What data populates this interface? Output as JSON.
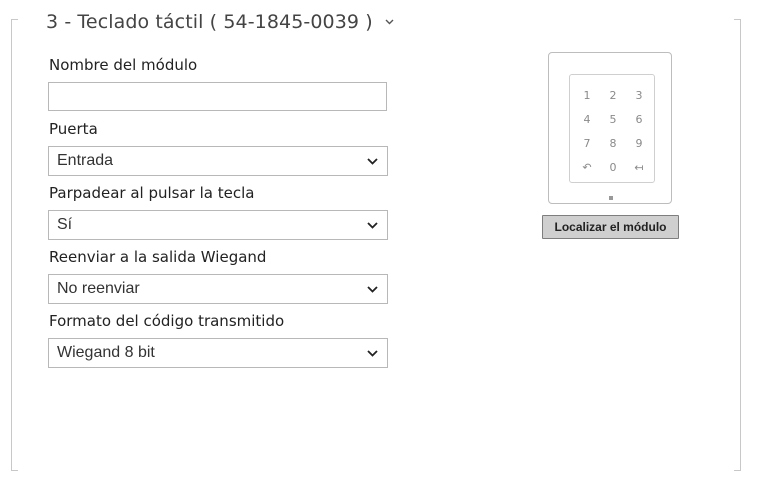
{
  "section": {
    "title": "3 - Teclado táctil ( 54-1845-0039 )",
    "collapse_icon": "chevron-down-icon"
  },
  "fields": {
    "module_name": {
      "label": "Nombre del módulo",
      "value": "",
      "placeholder": ""
    },
    "door": {
      "label": "Puerta",
      "value": "Entrada"
    },
    "blink_on_key": {
      "label": "Parpadear al pulsar la tecla",
      "value": "Sí"
    },
    "wiegand_forward": {
      "label": "Reenviar a la salida Wiegand",
      "value": "No reenviar"
    },
    "code_format": {
      "label": "Formato del código transmitido",
      "value": "Wiegand 8 bit"
    }
  },
  "device": {
    "keys": [
      "1",
      "2",
      "3",
      "4",
      "5",
      "6",
      "7",
      "8",
      "9",
      "↶",
      "0",
      "↤"
    ],
    "locate_button": "Localizar el módulo"
  },
  "colors": {
    "border": "#b8b8b8",
    "button_bg": "#cfcfcf",
    "key_text": "#8a8a8a"
  }
}
